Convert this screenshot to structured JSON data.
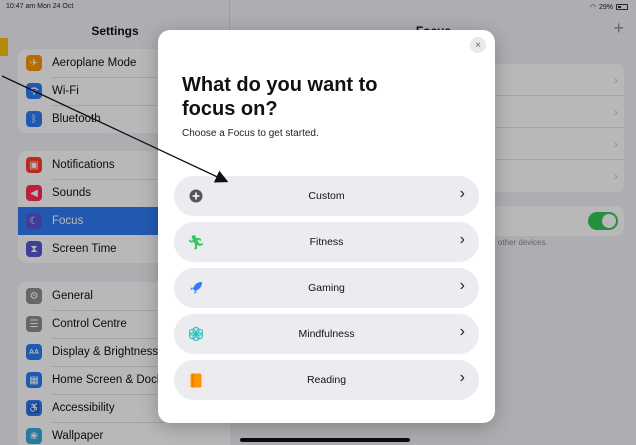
{
  "status_bar": {
    "time": "10:47 am  Mon 24 Oct",
    "battery": "29%"
  },
  "sidebar": {
    "title": "Settings",
    "groups": [
      {
        "items": [
          {
            "label": "Aeroplane Mode",
            "icon": "airplane-icon",
            "color": "#ff9500"
          },
          {
            "label": "Wi-Fi",
            "icon": "wifi-icon",
            "color": "#2f7cf6"
          },
          {
            "label": "Bluetooth",
            "icon": "bluetooth-icon",
            "color": "#2f7cf6"
          }
        ]
      },
      {
        "items": [
          {
            "label": "Notifications",
            "icon": "bell-icon",
            "color": "#ff3b30"
          },
          {
            "label": "Sounds",
            "icon": "speaker-icon",
            "color": "#ff2d55"
          },
          {
            "label": "Focus",
            "icon": "moon-icon",
            "color": "#5856d6",
            "selected": true
          },
          {
            "label": "Screen Time",
            "icon": "hourglass-icon",
            "color": "#5856d6"
          }
        ]
      },
      {
        "items": [
          {
            "label": "General",
            "icon": "gear-icon",
            "color": "#8e8e93"
          },
          {
            "label": "Control Centre",
            "icon": "toggles-icon",
            "color": "#8e8e93"
          },
          {
            "label": "Display & Brightness",
            "icon": "aa-icon",
            "color": "#2f7cf6"
          },
          {
            "label": "Home Screen & Dock",
            "icon": "grid-icon",
            "color": "#2f7cf6"
          },
          {
            "label": "Accessibility",
            "icon": "accessibility-icon",
            "color": "#2f7cf6"
          },
          {
            "label": "Wallpaper",
            "icon": "flower-icon",
            "color": "#34aadc"
          }
        ]
      }
    ]
  },
  "pane": {
    "title": "Focus",
    "plus": "+",
    "note": "r other devices."
  },
  "modal": {
    "heading": "What do you want to focus on?",
    "subtitle": "Choose a Focus to get started.",
    "close": "×",
    "options": [
      {
        "label": "Custom",
        "icon": "plus-circle-icon",
        "color": "#555555"
      },
      {
        "label": "Fitness",
        "icon": "running-icon",
        "color": "#34c759"
      },
      {
        "label": "Gaming",
        "icon": "rocket-icon",
        "color": "#2f7cf6"
      },
      {
        "label": "Mindfulness",
        "icon": "flower-icon",
        "color": "#30c0c0"
      },
      {
        "label": "Reading",
        "icon": "book-icon",
        "color": "#ff9500"
      }
    ]
  }
}
